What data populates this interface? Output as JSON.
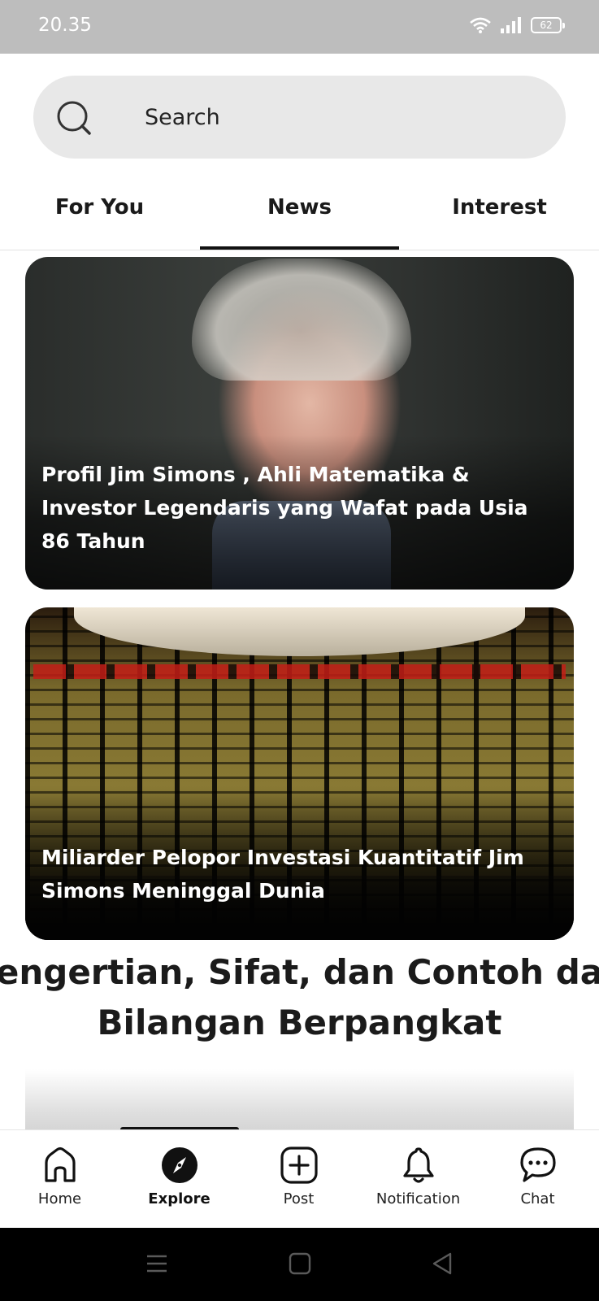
{
  "status_bar": {
    "time": "20.35",
    "battery": "62"
  },
  "search": {
    "placeholder": "Search"
  },
  "tabs": [
    {
      "label": "For You"
    },
    {
      "label": "News",
      "active": true
    },
    {
      "label": "Interest"
    }
  ],
  "feed": [
    {
      "title": "Profil Jim Simons , Ahli Matematika & Investor Legendaris yang Wafat pada Usia 86 Tahun"
    },
    {
      "title": "Miliarder Pelopor Investasi Kuantitatif Jim Simons Meninggal Dunia"
    },
    {
      "headline_line1": "engertian, Sifat, dan Contoh da",
      "headline_line2": "Bilangan Berpangkat"
    }
  ],
  "bottom_nav": [
    {
      "label": "Home",
      "icon": "home-icon"
    },
    {
      "label": "Explore",
      "icon": "compass-icon",
      "active": true
    },
    {
      "label": "Post",
      "icon": "plus-square-icon"
    },
    {
      "label": "Notification",
      "icon": "bell-icon"
    },
    {
      "label": "Chat",
      "icon": "chat-icon"
    }
  ],
  "colors": {
    "accent": "#111111",
    "search_bg": "#e8e8e8",
    "status_bar": "#bdbdbd"
  }
}
